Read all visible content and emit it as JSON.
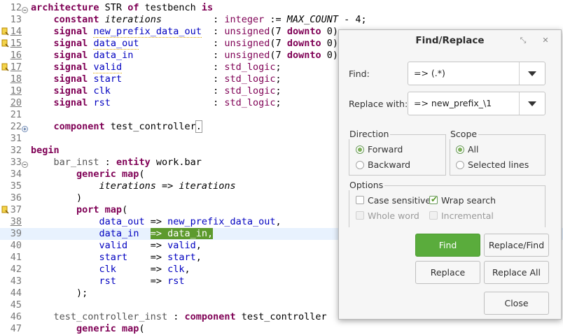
{
  "editor": {
    "lines": [
      {
        "num": "12",
        "html": "<span class=\"k\">architecture</span> STR <span class=\"k\">of</span> testbench <span class=\"k\">is</span>"
      },
      {
        "num": "13",
        "html": "    <span class=\"k\">constant</span> <span class=\"i\">iterations</span>         : <span class=\"t\">integer</span> := <span class=\"i\">MAX_COUNT</span> - 4;"
      },
      {
        "num": "14",
        "html": "    <span class=\"k\">signal</span> <span class=\"sig squig\">new_prefix_data_out</span>  : <span class=\"t\">unsigned</span>(7 <span class=\"k\">downto</span> 0);"
      },
      {
        "num": "15",
        "html": "    <span class=\"k\">signal</span> <span class=\"sig squig\">data_out</span>             : <span class=\"t\">unsigned</span>(7 <span class=\"k\">downto</span> 0);"
      },
      {
        "num": "16",
        "html": "    <span class=\"k\">signal</span> <span class=\"sig\">data_in</span>              : <span class=\"t\">unsigned</span>(7 <span class=\"k\">downto</span> 0);"
      },
      {
        "num": "17",
        "html": "    <span class=\"k\">signal</span> <span class=\"sig squig\">valid</span>                : <span class=\"t\">std_logic</span>;"
      },
      {
        "num": "18",
        "html": "    <span class=\"k\">signal</span> <span class=\"sig\">start</span>                : <span class=\"t\">std_logic</span>;"
      },
      {
        "num": "19",
        "html": "    <span class=\"k\">signal</span> <span class=\"sig\">clk</span>                  : <span class=\"t\">std_logic</span>;"
      },
      {
        "num": "20",
        "html": "    <span class=\"k\">signal</span> <span class=\"sig\">rst</span>                  : <span class=\"t\">std_logic</span>;"
      },
      {
        "num": "21",
        "html": ""
      },
      {
        "num": "22",
        "html": "    <span class=\"k\">component</span> test_controller<span class=\"box\">.</span>"
      },
      {
        "num": "31",
        "html": ""
      },
      {
        "num": "32",
        "html": "<span class=\"k\">begin</span>"
      },
      {
        "num": "33",
        "html": "    <span style=\"color:#555\">bar_inst</span> : <span class=\"k\">entity</span> work.bar"
      },
      {
        "num": "34",
        "html": "        <span class=\"k\">generic map</span>("
      },
      {
        "num": "35",
        "html": "            <span class=\"i\">iterations</span> => <span class=\"i\">iterations</span>"
      },
      {
        "num": "36",
        "html": "        )"
      },
      {
        "num": "37",
        "html": "        <span class=\"k\">port map</span>("
      },
      {
        "num": "38",
        "html": "            <span class=\"sig\">data_out</span> => <span class=\"sig\">new_prefix_data_out</span>,"
      },
      {
        "num": "39",
        "html": "            <span class=\"sig\">data_in</span>  <span class=\"sel\">=> data_in,</span>"
      },
      {
        "num": "40",
        "html": "            <span class=\"sig\">valid</span>    => <span class=\"sig\">valid</span>,"
      },
      {
        "num": "41",
        "html": "            <span class=\"sig\">start</span>    => <span class=\"sig\">start</span>,"
      },
      {
        "num": "42",
        "html": "            <span class=\"sig\">clk</span>      => <span class=\"sig\">clk</span>,"
      },
      {
        "num": "43",
        "html": "            <span class=\"sig\">rst</span>      => <span class=\"sig\">rst</span>"
      },
      {
        "num": "44",
        "html": "        );"
      },
      {
        "num": "45",
        "html": ""
      },
      {
        "num": "46",
        "html": "    <span style=\"color:#555\">test_controller_inst</span> : <span class=\"k\">component</span> test_controller"
      },
      {
        "num": "47",
        "html": "        <span class=\"k\">generic map</span>("
      }
    ]
  },
  "dialog": {
    "title": "Find/Replace",
    "find_label": "Find:",
    "find_value": "=> (.*)",
    "replace_label": "Replace with:",
    "replace_value": "=> new_prefix_\\1",
    "direction_label": "Direction",
    "forward_label": "Forward",
    "backward_label": "Backward",
    "scope_label": "Scope",
    "all_label": "All",
    "selected_lines_label": "Selected lines",
    "options_label": "Options",
    "case_sensitive_label": "Case sensitive",
    "wrap_search_label": "Wrap search",
    "whole_word_label": "Whole word",
    "incremental_label": "Incremental",
    "find_button": "Find",
    "replace_find_button": "Replace/Find",
    "replace_button": "Replace",
    "replace_all_button": "Replace All",
    "close_button": "Close"
  },
  "colors": {
    "keyword": "#7f0055",
    "signal": "#0000c0",
    "selection": "#5d9a2d",
    "primary_button": "#5aac3c"
  }
}
